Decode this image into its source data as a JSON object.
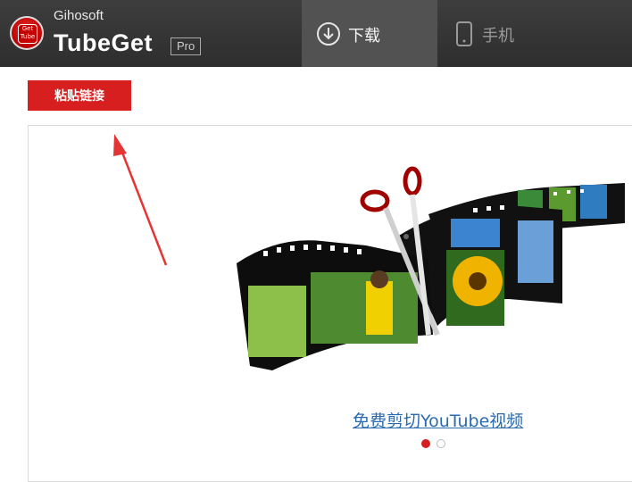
{
  "app": {
    "company": "Gihosoft",
    "product": "TubeGet",
    "edition": "Pro",
    "logo_text_top": "Get",
    "logo_text_bottom": "Tube"
  },
  "tabs": [
    {
      "label": "下载",
      "icon": "download-circle-icon",
      "active": true
    },
    {
      "label": "手机",
      "icon": "phone-icon",
      "active": false
    }
  ],
  "toolbar": {
    "paste_label": "粘贴链接"
  },
  "promo": {
    "caption": "免费剪切YouTube视频",
    "slides_total": 2,
    "slide_active": 1
  },
  "colors": {
    "accent": "#d71f1f",
    "titlebar": "#333333",
    "link": "#2a6bb0"
  }
}
